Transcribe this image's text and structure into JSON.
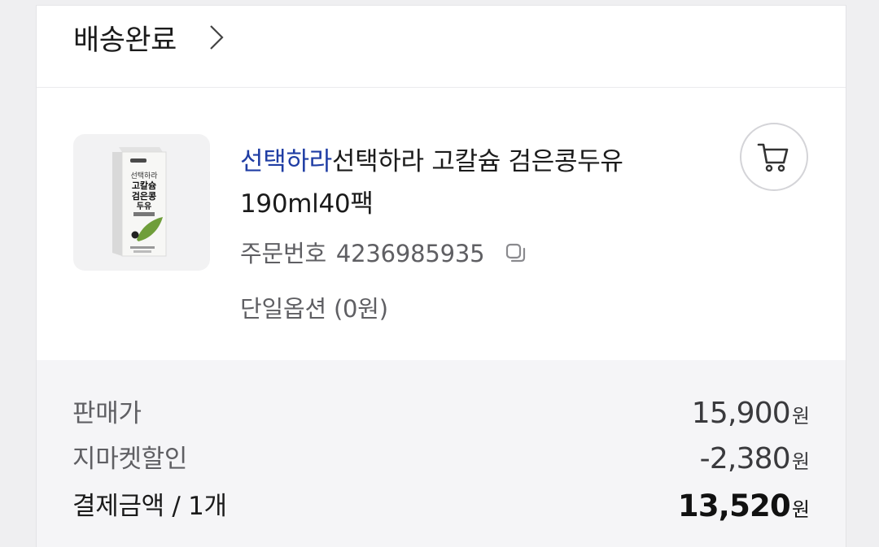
{
  "order": {
    "status_label": "배송완료",
    "product": {
      "brand": "선택하라",
      "title": "선택하라 고칼슘 검은콩두유 190ml40팩",
      "image_alt": "선택하라 고칼슘 검은콩 두유",
      "package_text": [
        "선택하라",
        "고칼슘",
        "검은콩",
        "두유"
      ]
    },
    "order_number_label": "주문번호",
    "order_number": "4236985935",
    "option_text": "단일옵션 (0원)"
  },
  "price_summary": {
    "rows": [
      {
        "label": "판매가",
        "amount": "15,900",
        "unit": "원"
      },
      {
        "label": "지마켓할인",
        "amount": "-2,380",
        "unit": "원"
      },
      {
        "label": "결제금액 / 1개",
        "amount": "13,520",
        "unit": "원"
      }
    ]
  },
  "colors": {
    "brand": "#1f3da4",
    "text_primary": "#1b1b1b",
    "text_secondary": "#5f5f63",
    "panel_bg": "#f5f5f7"
  },
  "icons": {
    "status_chevron": "chevron-right-icon",
    "cart": "cart-icon",
    "copy": "copy-icon"
  }
}
